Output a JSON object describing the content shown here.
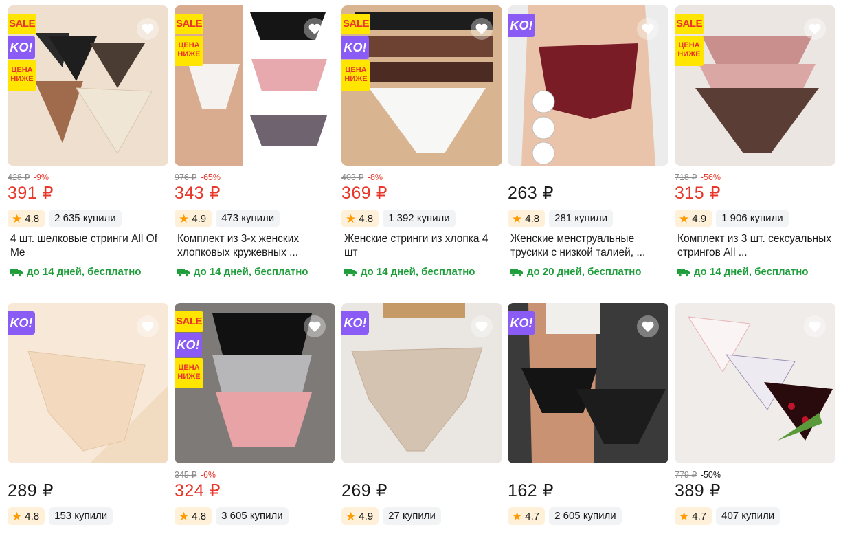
{
  "currency": "₽",
  "colors": {
    "sale_price": "#e8362a",
    "delivery": "#1f9e3b",
    "star": "#ff9a00",
    "ko_badge": "#8a5cf5",
    "sale_badge": "#ffe500"
  },
  "badges": {
    "sale": "SALE",
    "ko": "KO!",
    "lower_line1": "ЦЕНА",
    "lower_line2": "НИЖЕ"
  },
  "products": [
    {
      "id": "p1",
      "old_price": "428 ₽",
      "discount": "-9%",
      "price": "391 ₽",
      "rating": "4.8",
      "bought": "2 635 купили",
      "title": "4 шт. шелковые стринги All Of Me",
      "delivery": "до 14 дней, бесплатно"
    },
    {
      "id": "p2",
      "old_price": "976 ₽",
      "discount": "-65%",
      "price": "343 ₽",
      "rating": "4.9",
      "bought": "473 купили",
      "title": "Комплект из 3-х женских хлопковых кружевных ...",
      "delivery": "до 14 дней, бесплатно"
    },
    {
      "id": "p3",
      "old_price": "403 ₽",
      "discount": "-8%",
      "price": "369 ₽",
      "rating": "4.8",
      "bought": "1 392 купили",
      "title": "Женские стринги из хлопка 4 шт",
      "delivery": "до 14 дней, бесплатно"
    },
    {
      "id": "p4",
      "old_price": "",
      "discount": "",
      "price": "263 ₽",
      "rating": "4.8",
      "bought": "281 купили",
      "title": "Женские менструальные трусики с низкой талией, ...",
      "delivery": "до 20 дней, бесплатно"
    },
    {
      "id": "p5",
      "old_price": "718 ₽",
      "discount": "-56%",
      "price": "315 ₽",
      "rating": "4.9",
      "bought": "1 906 купили",
      "title": "Комплект из 3 шт. сексуальных стрингов All ...",
      "delivery": "до 14 дней, бесплатно"
    },
    {
      "id": "p6",
      "old_price": "",
      "discount": "",
      "price": "289 ₽",
      "rating": "4.8",
      "bought": "153 купили",
      "title": "",
      "delivery": ""
    },
    {
      "id": "p7",
      "old_price": "345 ₽",
      "discount": "-6%",
      "price": "324 ₽",
      "rating": "4.8",
      "bought": "3 605 купили",
      "title": "",
      "delivery": ""
    },
    {
      "id": "p8",
      "old_price": "",
      "discount": "",
      "price": "269 ₽",
      "rating": "4.9",
      "bought": "27 купили",
      "title": "",
      "delivery": ""
    },
    {
      "id": "p9",
      "old_price": "",
      "discount": "",
      "price": "162 ₽",
      "rating": "4.7",
      "bought": "2 605 купили",
      "title": "",
      "delivery": ""
    },
    {
      "id": "p10",
      "old_price": "779 ₽",
      "discount": "-50%",
      "price": "389 ₽",
      "rating": "4.7",
      "bought": "407 купили",
      "title": "",
      "delivery": ""
    }
  ],
  "icons": {
    "favorite": "heart-icon",
    "rating": "star-icon",
    "delivery": "truck-icon"
  }
}
